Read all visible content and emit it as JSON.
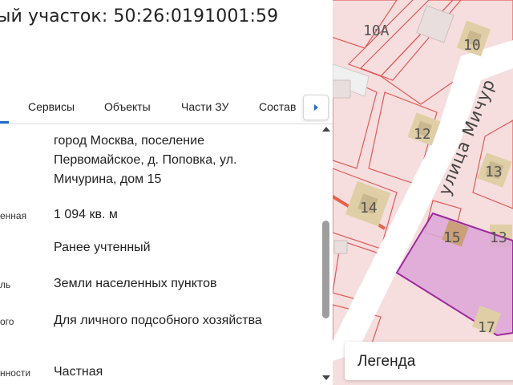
{
  "header": {
    "title": "ый участок: 50:26:0191001:59"
  },
  "tabs": [
    {
      "label": "Сервисы"
    },
    {
      "label": "Объекты"
    },
    {
      "label": "Части ЗУ"
    },
    {
      "label": "Состав"
    }
  ],
  "details": [
    {
      "label": "",
      "value": "город Москва, поселение Первомайское, д. Поповка, ул. Мичурина, дом 15"
    },
    {
      "label": "енная",
      "value": "1 094 кв. м"
    },
    {
      "label": "",
      "value": "Ранее учтенный"
    },
    {
      "label": "ль",
      "value": "Земли населенных пунктов"
    },
    {
      "label": "ого",
      "value": "Для личного подсобного хозяйства"
    },
    {
      "label": "нности",
      "value": "Частная"
    }
  ],
  "map": {
    "street_label": "улица Мичур",
    "parcel_numbers": [
      "10А",
      "10",
      "12",
      "13",
      "14",
      "15",
      "13",
      "17"
    ],
    "colors": {
      "background": "#f6dede",
      "parcel_border": "#e05a5a",
      "building": "#e0cfa6",
      "building_center": "#c9b88f",
      "selected_fill": "#dca6d8",
      "selected_border": "#9c2a9c",
      "road": "#ffffff"
    }
  },
  "legend": {
    "label": "Легенда"
  }
}
